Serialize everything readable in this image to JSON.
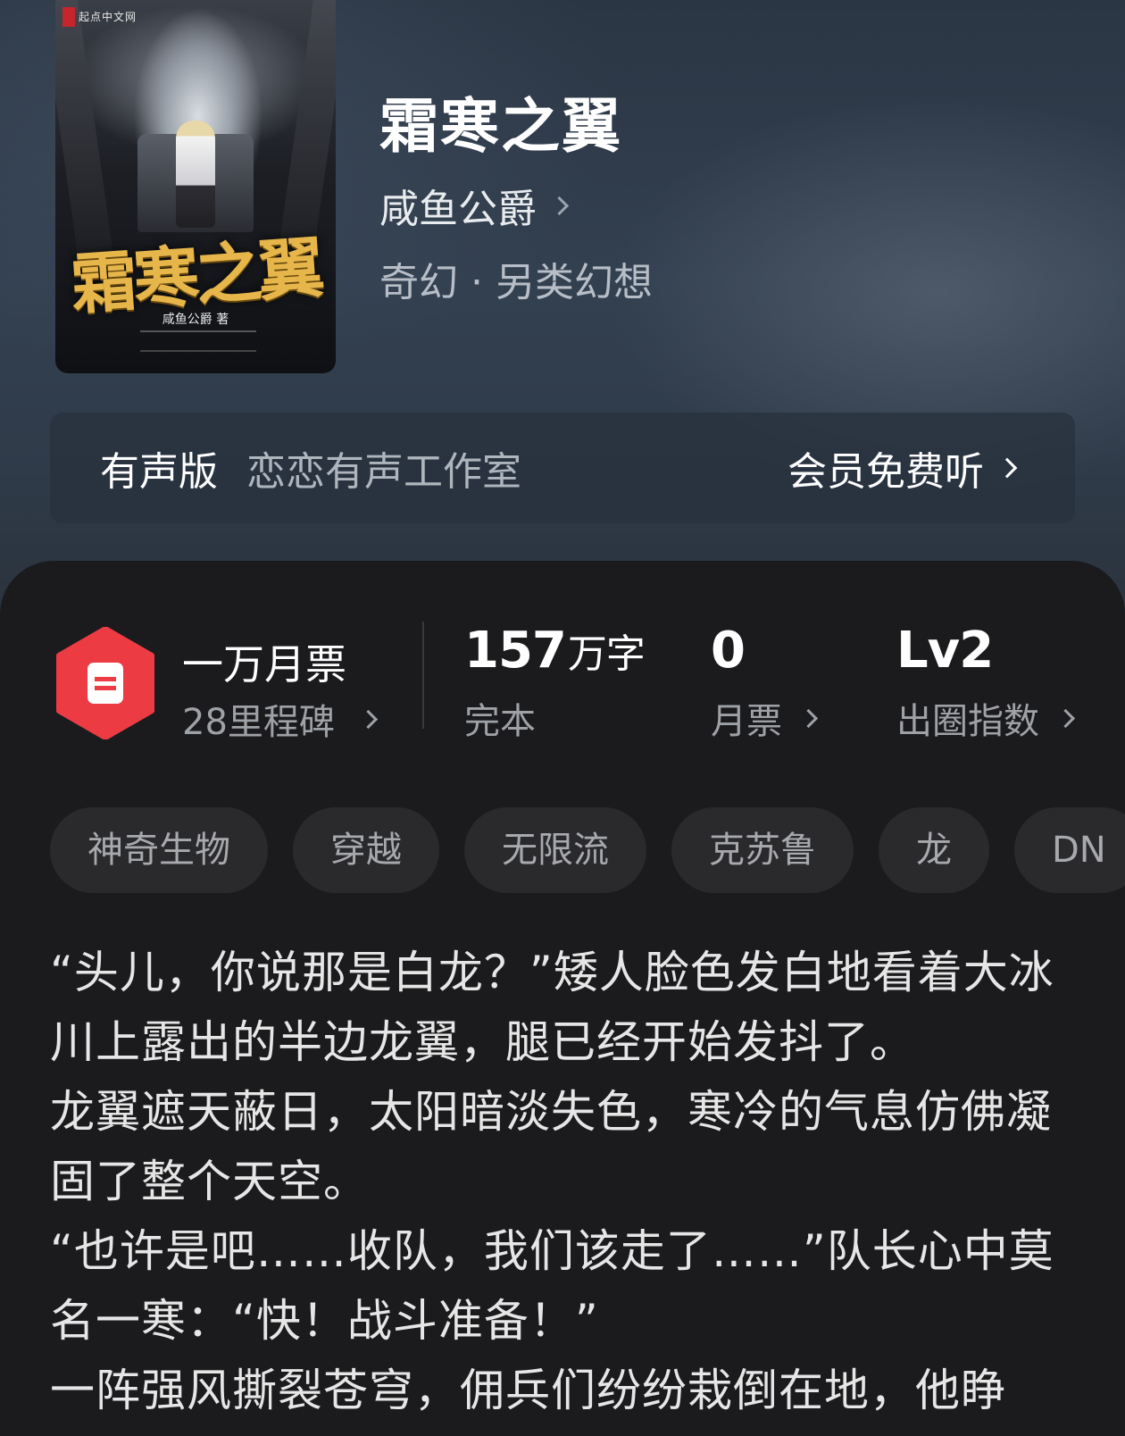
{
  "book": {
    "title": "霜寒之翼",
    "author": "咸鱼公爵",
    "genre": "奇幻 · 另类幻想",
    "cover": {
      "publisher_mark": "起点中文网",
      "title_art": "霜寒之翼",
      "author_art": "咸鱼公爵 著"
    }
  },
  "audio": {
    "label": "有声版",
    "studio": "恋恋有声工作室",
    "cta": "会员免费听"
  },
  "stats": {
    "monthly_title": "一万月票",
    "milestone": "28里程碑",
    "word_count_value": "157",
    "word_count_unit": "万字",
    "status": "完本",
    "monthly_votes_value": "0",
    "monthly_votes_label": "月票",
    "popularity_value": "Lv2",
    "popularity_label": "出圈指数"
  },
  "tags": [
    "神奇生物",
    "穿越",
    "无限流",
    "克苏鲁",
    "龙",
    "DN"
  ],
  "synopsis": [
    "“头儿，你说那是白龙？”矮人脸色发白地看着大冰川上露出的半边龙翼，腿已经开始发抖了。",
    "龙翼遮天蔽日，太阳暗淡失色，寒冷的气息仿佛凝固了整个天空。",
    "“也许是吧……收队，我们该走了……”队长心中莫名一寒：“快！战斗准备！”",
    "一阵强风撕裂苍穹，佣兵们纷纷栽倒在地，他睁"
  ],
  "colors": {
    "badge_red": "#ec3b43",
    "sheet_bg": "#1b1b1d",
    "tag_bg": "#2a2a2d",
    "hero_bg": "#334050"
  }
}
